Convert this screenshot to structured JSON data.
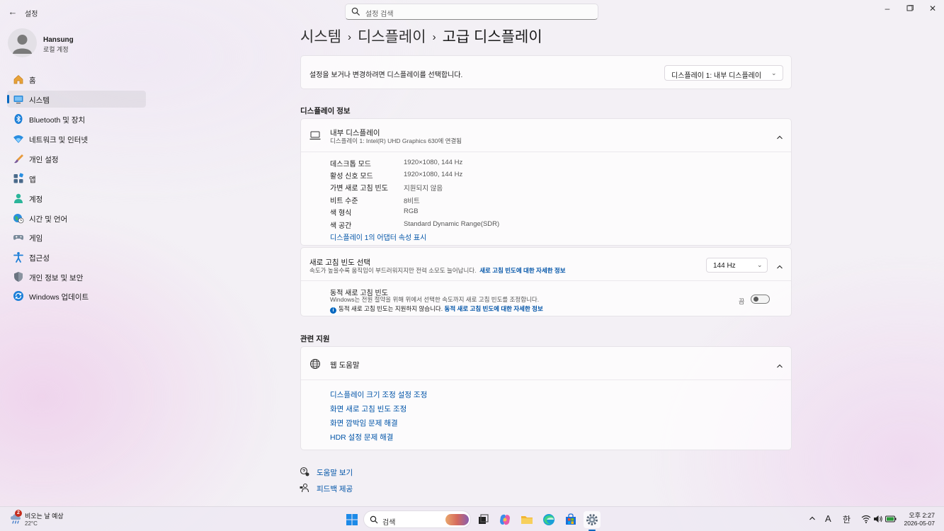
{
  "window": {
    "title": "설정",
    "search_placeholder": "설정 검색"
  },
  "user": {
    "name": "Hansung",
    "account_type": "로컬 계정"
  },
  "nav": {
    "items": [
      {
        "label": "홈",
        "icon": "home-icon"
      },
      {
        "label": "시스템",
        "icon": "system-icon",
        "active": true
      },
      {
        "label": "Bluetooth 및 장치",
        "icon": "bluetooth-icon"
      },
      {
        "label": "네트워크 및 인터넷",
        "icon": "network-icon"
      },
      {
        "label": "개인 설정",
        "icon": "brush-icon"
      },
      {
        "label": "앱",
        "icon": "apps-icon"
      },
      {
        "label": "계정",
        "icon": "account-icon"
      },
      {
        "label": "시간 및 언어",
        "icon": "globe-clock-icon"
      },
      {
        "label": "게임",
        "icon": "gamepad-icon"
      },
      {
        "label": "접근성",
        "icon": "accessibility-icon"
      },
      {
        "label": "개인 정보 및 보안",
        "icon": "shield-icon"
      },
      {
        "label": "Windows 업데이트",
        "icon": "update-icon"
      }
    ]
  },
  "breadcrumb": {
    "part1": "시스템",
    "part2": "디스플레이",
    "part3": "고급 디스플레이",
    "separator": "›"
  },
  "display_select": {
    "prompt": "설정을 보거나 변경하려면 디스플레이를 선택합니다.",
    "selected": "디스플레이 1: 내부 디스플레이"
  },
  "display_info": {
    "section_title": "디스플레이 정보",
    "name": "내부 디스플레이",
    "subtitle": "디스플레이 1: Intel(R) UHD Graphics 630에 연결됨",
    "specs": [
      {
        "label": "데스크톱 모드",
        "value": "1920×1080, 144 Hz"
      },
      {
        "label": "활성 신호 모드",
        "value": "1920×1080, 144 Hz"
      },
      {
        "label": "가변 새로 고침 빈도",
        "value": "지원되지 않음"
      },
      {
        "label": "비트 수준",
        "value": "8비트"
      },
      {
        "label": "색 형식",
        "value": "RGB"
      },
      {
        "label": "색 공간",
        "value": "Standard Dynamic Range(SDR)"
      }
    ],
    "adapter_link": "디스플레이 1의 어댑터 속성 표시"
  },
  "refresh": {
    "title": "새로 고침 빈도 선택",
    "description": "속도가 높을수록 움직임이 부드러워지지만 전력 소모도 늘어납니다.",
    "more_link": "새로 고침 빈도에 대한 자세한 정보",
    "selected_rate": "144 Hz",
    "dynamic_title": "동적 새로 고침 빈도",
    "dynamic_desc": "Windows는 전원 절약을 위해 위에서 선택한 속도까지 새로 고침 빈도를 조정합니다.",
    "dynamic_note": "동적 새로 고침 빈도는 지원하지 않습니다.",
    "dynamic_link": "동적 새로 고침 빈도에 대한 자세한 정보",
    "toggle_state": "끔",
    "toggle_on": false
  },
  "related": {
    "section_title": "관련 지원",
    "web_help_title": "웹 도움말",
    "links": [
      "디스플레이 크기 조정 설정 조정",
      "화면 새로 고침 빈도 조정",
      "화면 깜박임 문제 해결",
      "HDR 설정 문제 해결"
    ]
  },
  "footer": {
    "help": "도움말 보기",
    "feedback": "피드백 제공"
  },
  "taskbar": {
    "weather_text": "비오는 날 예상",
    "weather_temp": "22°C",
    "weather_badge": "2",
    "search_label": "검색",
    "ime_mode": "A",
    "ime_lang": "한",
    "time": "오후 2:27",
    "date": "2026-05-07"
  },
  "colors": {
    "accent": "#0067c0",
    "link": "#0054a8"
  }
}
